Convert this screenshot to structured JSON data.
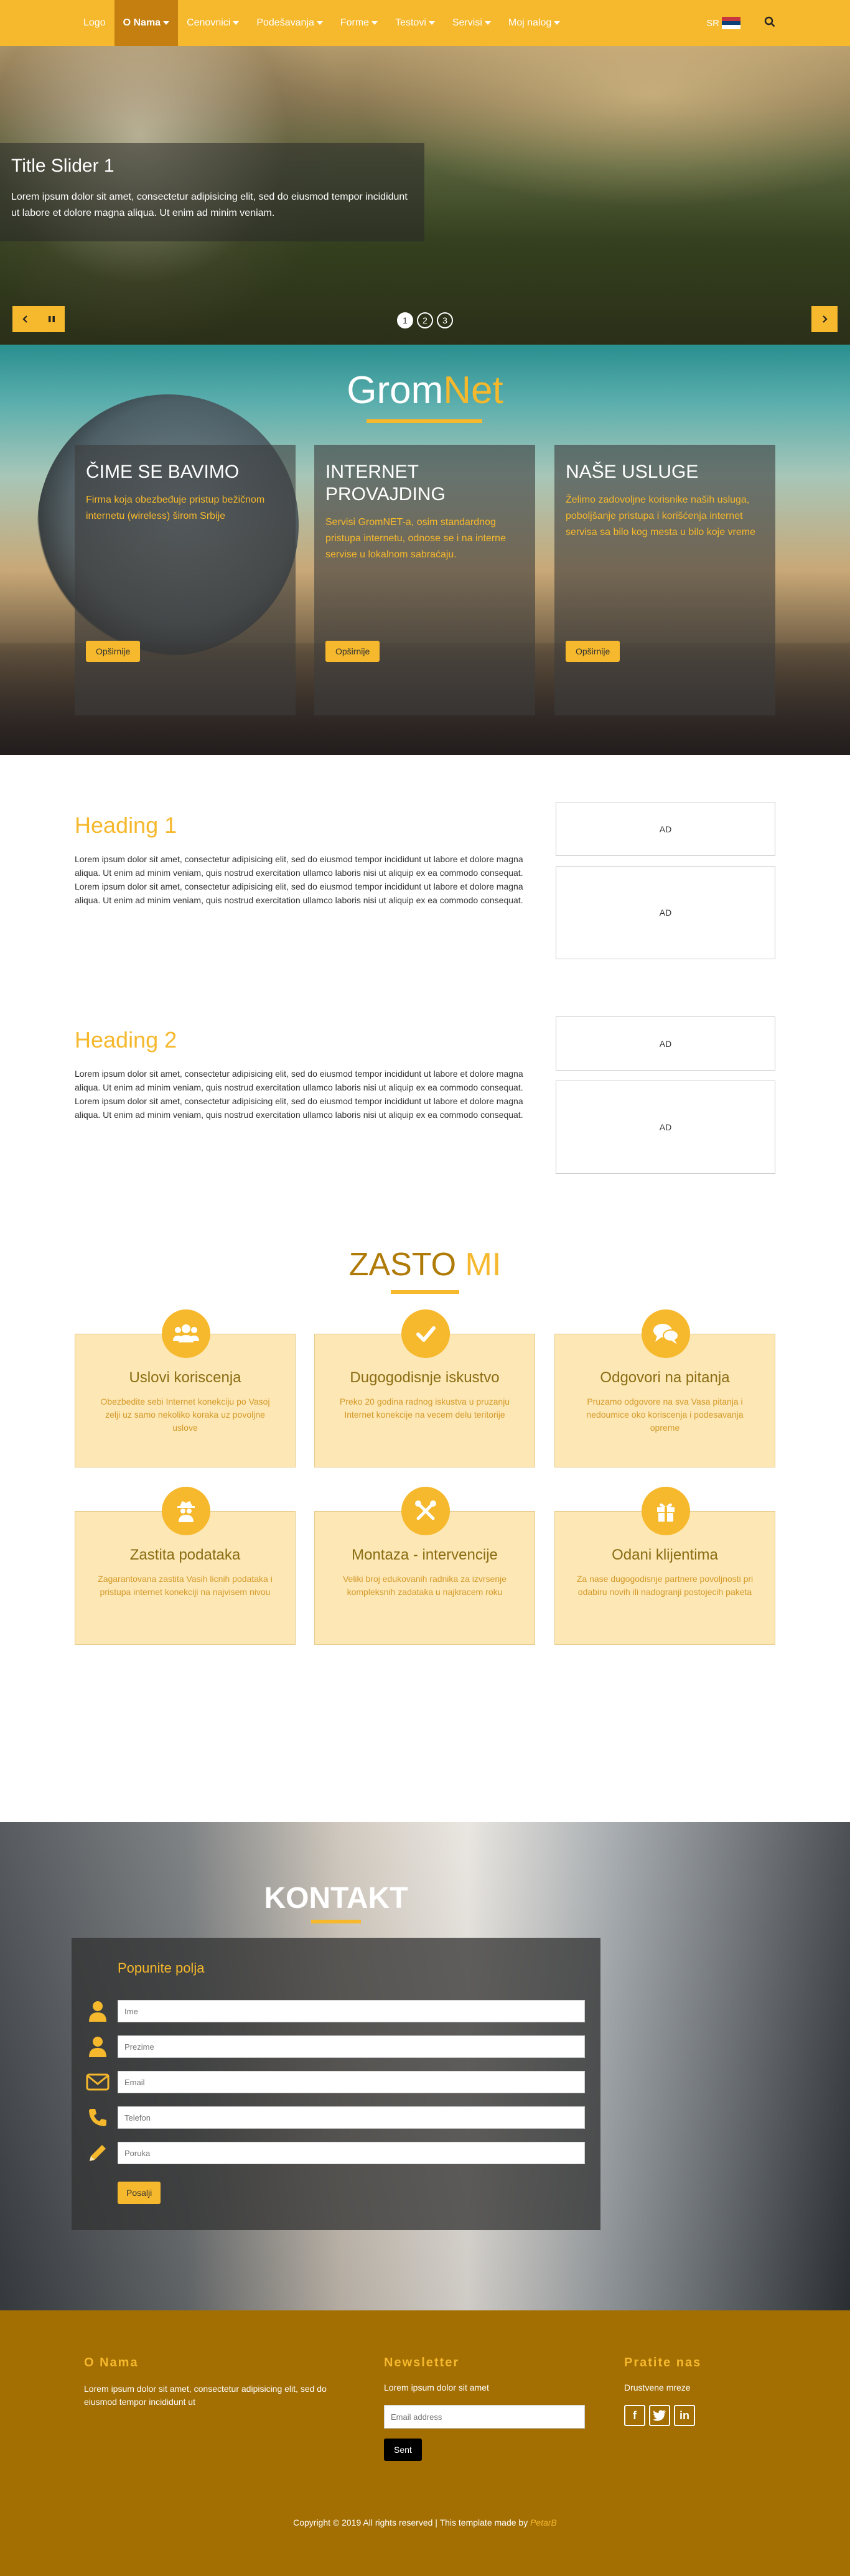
{
  "nav": {
    "logo": "Logo",
    "items": [
      {
        "label": "O Nama",
        "active": true
      },
      {
        "label": "Cenovnici"
      },
      {
        "label": "Podešavanja"
      },
      {
        "label": "Forme"
      },
      {
        "label": "Testovi"
      },
      {
        "label": "Servisi"
      },
      {
        "label": "Moj nalog"
      }
    ],
    "lang": "SR"
  },
  "hero": {
    "title": "Title Slider 1",
    "text": "Lorem ipsum dolor sit amet, consectetur adipisicing elit, sed do eiusmod tempor incididunt ut labore et dolore magna aliqua. Ut enim ad minim veniam.",
    "indicators": [
      "1",
      "2",
      "3"
    ]
  },
  "gromnet": {
    "brand_part1": "Grom",
    "brand_part2": "Net",
    "cards": [
      {
        "title": "ČIME SE BAVIMO",
        "text": "Firma koja obezbeđuje pristup bežičnom internetu (wireless) širom Srbije",
        "button": "Opširnije"
      },
      {
        "title": "INTERNET PROVAJDING",
        "text": "Servisi GromNET-a, osim standardnog pristupa internetu, odnose se i na interne servise u lokalnom sabraćaju.",
        "button": "Opširnije"
      },
      {
        "title": "NAŠE USLUGE",
        "text": "Želimo zadovoljne korisnike naših usluga, poboljšanje pristupa i korišćenja internet servisa sa bilo kog mesta u bilo koje vreme",
        "button": "Opširnije"
      }
    ]
  },
  "sections": [
    {
      "heading": "Heading 1",
      "text": "Lorem ipsum dolor sit amet, consectetur adipisicing elit, sed do eiusmod tempor incididunt ut labore et dolore magna aliqua. Ut enim ad minim veniam, quis nostrud exercitation ullamco laboris nisi ut aliquip ex ea commodo consequat. Lorem ipsum dolor sit amet, consectetur adipisicing elit, sed do eiusmod tempor incididunt ut labore et dolore magna aliqua. Ut enim ad minim veniam, quis nostrud exercitation ullamco laboris nisi ut aliquip ex ea commodo consequat.",
      "ads": [
        "AD",
        "AD"
      ]
    },
    {
      "heading": "Heading 2",
      "text": "Lorem ipsum dolor sit amet, consectetur adipisicing elit, sed do eiusmod tempor incididunt ut labore et dolore magna aliqua. Ut enim ad minim veniam, quis nostrud exercitation ullamco laboris nisi ut aliquip ex ea commodo consequat. Lorem ipsum dolor sit amet, consectetur adipisicing elit, sed do eiusmod tempor incididunt ut labore et dolore magna aliqua. Ut enim ad minim veniam, quis nostrud exercitation ullamco laboris nisi ut aliquip ex ea commodo consequat.",
      "ads": [
        "AD",
        "AD"
      ]
    }
  ],
  "zasto": {
    "title_part1": "ZASTO",
    "title_part2": "MI",
    "features": [
      {
        "icon": "users-icon",
        "title": "Uslovi koriscenja",
        "text": "Obezbedite sebi Internet konekciju po Vasoj zelji uz samo nekoliko koraka uz povoljne uslove"
      },
      {
        "icon": "check-icon",
        "title": "Dugogodisnje iskustvo",
        "text": "Preko 20 godina radnog iskustva u pruzanju Internet konekcije na vecem delu teritorije"
      },
      {
        "icon": "chat-icon",
        "title": "Odgovori na pitanja",
        "text": "Pruzamo odgovore na sva Vasa pitanja i nedoumice oko koriscenja i podesavanja opreme"
      },
      {
        "icon": "spy-icon",
        "title": "Zastita podataka",
        "text": "Zagarantovana zastita Vasih licnih podataka i pristupa internet konekciji na najvisem nivou"
      },
      {
        "icon": "tools-icon",
        "title": "Montaza - intervencije",
        "text": "Veliki broj edukovanih radnika za izvrsenje kompleksnih zadataka u najkracem roku"
      },
      {
        "icon": "gift-icon",
        "title": "Odani klijentima",
        "text": "Za nase dugogodisnje partnere povoljnosti pri odabiru novih ili nadogranji postojecih paketa"
      }
    ]
  },
  "kontakt": {
    "title": "KONTAKT",
    "form_title": "Popunite polja",
    "fields": [
      {
        "icon": "user-icon",
        "placeholder": "Ime"
      },
      {
        "icon": "user-icon",
        "placeholder": "Prezime"
      },
      {
        "icon": "envelope-icon",
        "placeholder": "Email"
      },
      {
        "icon": "phone-icon",
        "placeholder": "Telefon"
      },
      {
        "icon": "pencil-icon",
        "placeholder": "Poruka"
      }
    ],
    "submit": "Posalji"
  },
  "footer": {
    "about_title": "O Nama",
    "about_text": "Lorem ipsum dolor sit amet, consectetur adipisicing elit, sed do eiusmod tempor incididunt ut",
    "newsletter_title": "Newsletter",
    "newsletter_text": "Lorem ipsum dolor sit amet",
    "email_placeholder": "Email address",
    "send": "Sent",
    "follow_title": "Pratite nas",
    "follow_text": "Drustvene mreze",
    "copyright": "Copyright © 2019 All rights reserved | This template made by",
    "author": "PetarB"
  },
  "colors": {
    "accent": "#f6b82c",
    "dark_accent": "#a36f02",
    "feature_bg": "#fde7b4"
  }
}
